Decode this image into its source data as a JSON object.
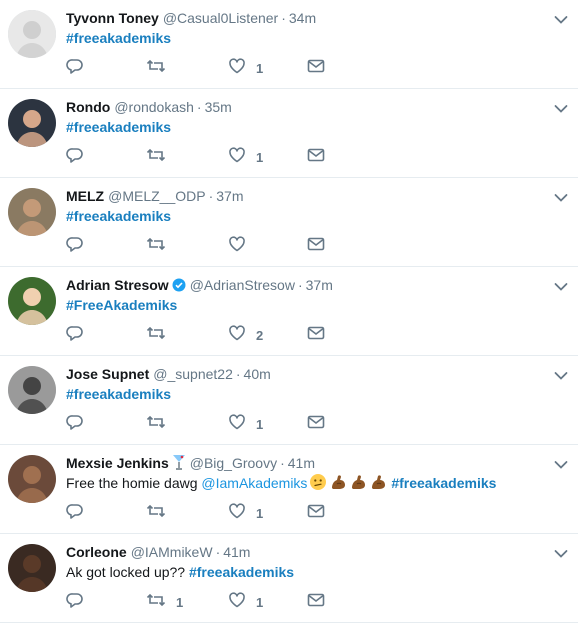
{
  "colors": {
    "link": "#1b95e0",
    "hashtag": "#1a7fbf",
    "meta": "#657786",
    "icon": "#657786",
    "verified": "#1da1f2",
    "divider": "#e6ecf0"
  },
  "tweets": [
    {
      "name": "Tyvonn Toney",
      "handle": "@Casual0Listener",
      "time": "34m",
      "text_before": "",
      "mention": "",
      "hashtag": "#freeakademiks",
      "text_after": "",
      "reply_count": "",
      "retweet_count": "",
      "like_count": "1",
      "verified": false,
      "name_badge": ""
    },
    {
      "name": "Rondo",
      "handle": "@rondokash",
      "time": "35m",
      "text_before": "",
      "mention": "",
      "hashtag": "#freeakademiks",
      "text_after": "",
      "reply_count": "",
      "retweet_count": "",
      "like_count": "1",
      "verified": false,
      "name_badge": ""
    },
    {
      "name": "MELZ",
      "handle": "@MELZ__ODP",
      "time": "37m",
      "text_before": "",
      "mention": "",
      "hashtag": "#freeakademiks",
      "text_after": "",
      "reply_count": "",
      "retweet_count": "",
      "like_count": "",
      "verified": false,
      "name_badge": ""
    },
    {
      "name": "Adrian Stresow",
      "handle": "@AdrianStresow",
      "time": "37m",
      "text_before": "",
      "mention": "",
      "hashtag": "#FreeAkademiks",
      "text_after": "",
      "reply_count": "",
      "retweet_count": "",
      "like_count": "2",
      "verified": true,
      "name_badge": ""
    },
    {
      "name": "Jose Supnet",
      "handle": "@_supnet22",
      "time": "40m",
      "text_before": "",
      "mention": "",
      "hashtag": "#freeakademiks",
      "text_after": "",
      "reply_count": "",
      "retweet_count": "",
      "like_count": "1",
      "verified": false,
      "name_badge": ""
    },
    {
      "name": "Mexsie Jenkins",
      "handle": "@Big_Groovy",
      "time": "41m",
      "text_before": "Free the homie dawg ",
      "mention": "@IamAkademiks",
      "hashtag": "#freeakademiks",
      "text_after": "",
      "reply_count": "",
      "retweet_count": "",
      "like_count": "1",
      "verified": false,
      "name_badge": "cocktail-glass",
      "emojis": [
        "confused-face",
        "flexed-biceps",
        "flexed-biceps",
        "flexed-biceps"
      ]
    },
    {
      "name": "Corleone",
      "handle": "@IAMmikeW",
      "time": "41m",
      "text_before": "Ak got locked up?? ",
      "mention": "",
      "hashtag": "#freeakademiks",
      "text_after": "",
      "reply_count": "",
      "retweet_count": "1",
      "like_count": "1",
      "verified": false,
      "name_badge": ""
    }
  ],
  "icons": {
    "reply": "reply-icon",
    "retweet": "retweet-icon",
    "like": "heart-icon",
    "dm": "envelope-icon",
    "menu": "chevron-down-icon"
  }
}
